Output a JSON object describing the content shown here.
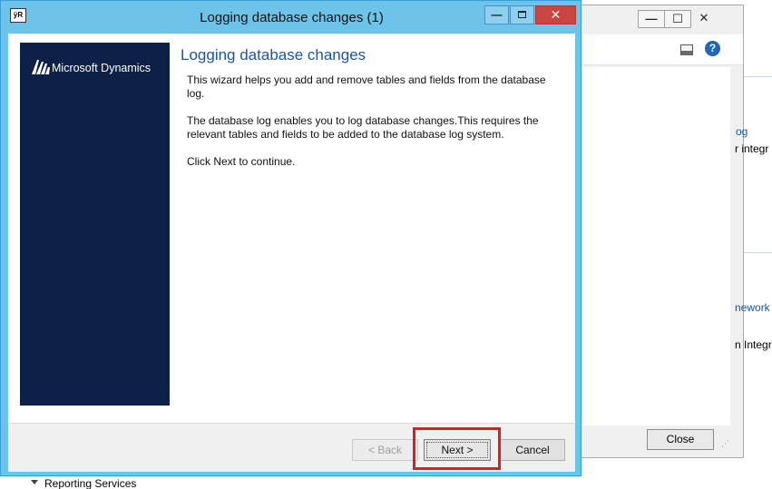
{
  "background_window": {
    "controls": {
      "minimize": "—",
      "maximize": "☐",
      "close": "✕"
    },
    "help_icon": "?",
    "fragments": [
      {
        "key": "og",
        "text": "og",
        "color": "blue"
      },
      {
        "key": "r_integr",
        "text": "r integr",
        "color": "black"
      },
      {
        "key": "nework",
        "text": "nework",
        "color": "blue"
      },
      {
        "key": "n_integr",
        "text": "n Integr",
        "color": "black"
      }
    ],
    "close_label": "Close"
  },
  "tree": {
    "item_label": "Reporting Services"
  },
  "dialog": {
    "title": "Logging database changes (1)",
    "app_icon_text": "ÿR",
    "controls": {
      "minimize": "—",
      "close": "✕"
    },
    "brand": "Microsoft Dynamics",
    "heading": "Logging database changes",
    "paragraphs": [
      "This wizard helps you add and remove tables and fields from the database log.",
      "The database log enables you to log database changes.This requires the relevant tables and fields to be added to the database log system.",
      "Click Next to continue."
    ],
    "buttons": {
      "back": "< Back",
      "next": "Next >",
      "cancel": "Cancel"
    }
  },
  "colors": {
    "frame": "#6ec3ea",
    "brand_panel": "#0d2148",
    "heading": "#1a56a6",
    "highlight": "#e01b24",
    "close_button": "#c74740"
  }
}
